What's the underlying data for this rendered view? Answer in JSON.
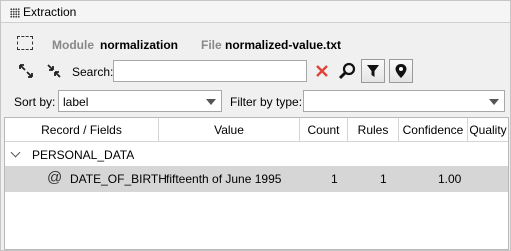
{
  "panel": {
    "title": "Extraction"
  },
  "info": {
    "module_label": "Module",
    "module_value": "normalization",
    "file_label": "File",
    "file_value": "normalized-value.txt"
  },
  "search": {
    "label": "Search:",
    "value": ""
  },
  "sort": {
    "label": "Sort by:",
    "value": "label"
  },
  "filter": {
    "label": "Filter by type:",
    "value": ""
  },
  "table": {
    "columns": [
      "Record / Fields",
      "Value",
      "Count",
      "Rules",
      "Confidence",
      "Quality"
    ],
    "group": "PERSONAL_DATA",
    "record": {
      "name": "DATE_OF_BIRTH",
      "value": "fifteenth of June 1995",
      "count": "1",
      "rules": "1",
      "confidence": "1.00",
      "quality": ""
    }
  },
  "colors": {
    "selected_row": "#d6d6d6",
    "clear_icon": "#e0443a"
  }
}
